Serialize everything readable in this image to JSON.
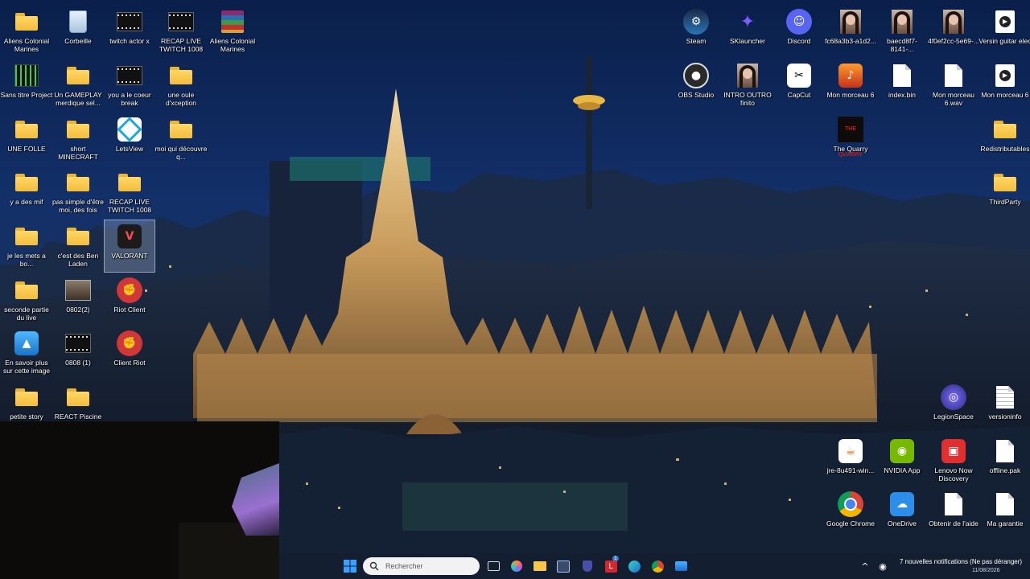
{
  "desktop": {
    "icons": [
      {
        "label": "Aliens Colonial Marines",
        "icon": "folder-icon"
      },
      {
        "label": "Corbeille",
        "icon": "recycle-bin-icon"
      },
      {
        "label": "twitch actor x",
        "icon": "video-file-icon"
      },
      {
        "label": "RECAP LIVE TWITCH 1008",
        "icon": "video-file-icon"
      },
      {
        "label": "Aliens Colonial Marines",
        "icon": "winrar-archive-icon"
      },
      {
        "label": "Sans titre Project",
        "icon": "project-file-icon"
      },
      {
        "label": "Un GAMEPLAY merdique sel...",
        "icon": "folder-icon"
      },
      {
        "label": "you a le coeur break",
        "icon": "video-file-icon"
      },
      {
        "label": "une oule d'xception",
        "icon": "folder-icon"
      },
      {
        "label": "UNE FOLLE",
        "icon": "folder-icon"
      },
      {
        "label": "short MINECRAFT",
        "icon": "folder-icon"
      },
      {
        "label": "LetsView",
        "icon": "letsview-icon"
      },
      {
        "label": "moi qui découvre q...",
        "icon": "folder-icon"
      },
      {
        "label": "y a des mif",
        "icon": "folder-icon"
      },
      {
        "label": "pas simple d'être moi, des fois",
        "icon": "folder-icon"
      },
      {
        "label": "RECAP LIVE TWITCH 1008 f...",
        "icon": "folder-icon"
      },
      {
        "label": "je les mets a bo...",
        "icon": "folder-icon"
      },
      {
        "label": "c'est des Ben Laden",
        "icon": "folder-icon"
      },
      {
        "label": "VALORANT",
        "icon": "valorant-icon"
      },
      {
        "label": "seconde partie du live",
        "icon": "folder-icon"
      },
      {
        "label": "0802(2)",
        "icon": "image-file-icon"
      },
      {
        "label": "Riot Client",
        "icon": "riot-client-icon"
      },
      {
        "label": "En savoir plus sur cette image",
        "icon": "spotlight-icon"
      },
      {
        "label": "0808 (1)",
        "icon": "video-file-icon"
      },
      {
        "label": "Client Riot",
        "icon": "riot-client-icon"
      },
      {
        "label": "petite story",
        "icon": "folder-icon"
      },
      {
        "label": "REACT Piscine",
        "icon": "folder-icon"
      },
      {
        "label": "Steam",
        "icon": "steam-icon"
      },
      {
        "label": "SKlauncher",
        "icon": "sklauncher-icon"
      },
      {
        "label": "Discord",
        "icon": "discord-icon"
      },
      {
        "label": "fc68a3b3-a1d2...",
        "icon": "photo-file-icon"
      },
      {
        "label": "baecd8f7-8141-...",
        "icon": "photo-file-icon"
      },
      {
        "label": "4f0ef2cc-5e69-...",
        "icon": "photo-file-icon"
      },
      {
        "label": "Versin guitar elec",
        "icon": "audio-file-icon"
      },
      {
        "label": "OBS Studio",
        "icon": "obs-icon"
      },
      {
        "label": "INTRO OUTRO finito",
        "icon": "photo-file-icon"
      },
      {
        "label": "CapCut",
        "icon": "capcut-icon"
      },
      {
        "label": "Mon morceau 6",
        "icon": "guitar-file-icon"
      },
      {
        "label": "index.bin",
        "icon": "blank-file-icon"
      },
      {
        "label": "Mon morceau 6.wav",
        "icon": "wav-file-icon"
      },
      {
        "label": "Mon morceau 6",
        "icon": "audio-file-icon"
      },
      {
        "label": "The Quarry",
        "icon": "the-quarry-icon"
      },
      {
        "label": "Redistributables",
        "icon": "folder-icon"
      },
      {
        "label": "ThirdParty",
        "icon": "folder-icon"
      },
      {
        "label": "LegionSpace",
        "icon": "legionspace-icon"
      },
      {
        "label": "versioninfo",
        "icon": "text-file-icon"
      },
      {
        "label": "jre-8u491-win...",
        "icon": "java-icon"
      },
      {
        "label": "NVIDIA App",
        "icon": "nvidia-icon"
      },
      {
        "label": "Lenovo Now Discovery",
        "icon": "lenovo-now-icon"
      },
      {
        "label": "offline.pak",
        "icon": "blank-file-icon"
      },
      {
        "label": "Google Chrome",
        "icon": "chrome-icon"
      },
      {
        "label": "OneDrive",
        "icon": "onedrive-icon"
      },
      {
        "label": "Obtenir de l'aide",
        "icon": "blank-file-icon"
      },
      {
        "label": "Ma garantie",
        "icon": "blank-file-icon"
      }
    ]
  },
  "taskbar": {
    "search_placeholder": "Rechercher",
    "notifications": "7 nouvelles notifications (Ne pas déranger)",
    "date": "11/08/2026",
    "badge_count": "1"
  }
}
